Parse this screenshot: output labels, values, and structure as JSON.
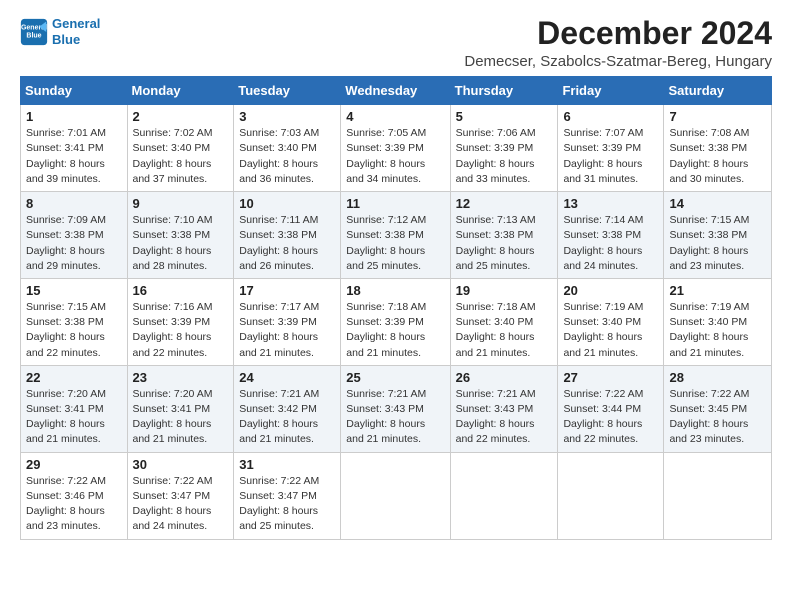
{
  "logo": {
    "line1": "General",
    "line2": "Blue"
  },
  "title": "December 2024",
  "location": "Demecser, Szabolcs-Szatmar-Bereg, Hungary",
  "days_header": [
    "Sunday",
    "Monday",
    "Tuesday",
    "Wednesday",
    "Thursday",
    "Friday",
    "Saturday"
  ],
  "weeks": [
    [
      {
        "num": "1",
        "sunrise": "Sunrise: 7:01 AM",
        "sunset": "Sunset: 3:41 PM",
        "daylight": "Daylight: 8 hours and 39 minutes."
      },
      {
        "num": "2",
        "sunrise": "Sunrise: 7:02 AM",
        "sunset": "Sunset: 3:40 PM",
        "daylight": "Daylight: 8 hours and 37 minutes."
      },
      {
        "num": "3",
        "sunrise": "Sunrise: 7:03 AM",
        "sunset": "Sunset: 3:40 PM",
        "daylight": "Daylight: 8 hours and 36 minutes."
      },
      {
        "num": "4",
        "sunrise": "Sunrise: 7:05 AM",
        "sunset": "Sunset: 3:39 PM",
        "daylight": "Daylight: 8 hours and 34 minutes."
      },
      {
        "num": "5",
        "sunrise": "Sunrise: 7:06 AM",
        "sunset": "Sunset: 3:39 PM",
        "daylight": "Daylight: 8 hours and 33 minutes."
      },
      {
        "num": "6",
        "sunrise": "Sunrise: 7:07 AM",
        "sunset": "Sunset: 3:39 PM",
        "daylight": "Daylight: 8 hours and 31 minutes."
      },
      {
        "num": "7",
        "sunrise": "Sunrise: 7:08 AM",
        "sunset": "Sunset: 3:38 PM",
        "daylight": "Daylight: 8 hours and 30 minutes."
      }
    ],
    [
      {
        "num": "8",
        "sunrise": "Sunrise: 7:09 AM",
        "sunset": "Sunset: 3:38 PM",
        "daylight": "Daylight: 8 hours and 29 minutes."
      },
      {
        "num": "9",
        "sunrise": "Sunrise: 7:10 AM",
        "sunset": "Sunset: 3:38 PM",
        "daylight": "Daylight: 8 hours and 28 minutes."
      },
      {
        "num": "10",
        "sunrise": "Sunrise: 7:11 AM",
        "sunset": "Sunset: 3:38 PM",
        "daylight": "Daylight: 8 hours and 26 minutes."
      },
      {
        "num": "11",
        "sunrise": "Sunrise: 7:12 AM",
        "sunset": "Sunset: 3:38 PM",
        "daylight": "Daylight: 8 hours and 25 minutes."
      },
      {
        "num": "12",
        "sunrise": "Sunrise: 7:13 AM",
        "sunset": "Sunset: 3:38 PM",
        "daylight": "Daylight: 8 hours and 25 minutes."
      },
      {
        "num": "13",
        "sunrise": "Sunrise: 7:14 AM",
        "sunset": "Sunset: 3:38 PM",
        "daylight": "Daylight: 8 hours and 24 minutes."
      },
      {
        "num": "14",
        "sunrise": "Sunrise: 7:15 AM",
        "sunset": "Sunset: 3:38 PM",
        "daylight": "Daylight: 8 hours and 23 minutes."
      }
    ],
    [
      {
        "num": "15",
        "sunrise": "Sunrise: 7:15 AM",
        "sunset": "Sunset: 3:38 PM",
        "daylight": "Daylight: 8 hours and 22 minutes."
      },
      {
        "num": "16",
        "sunrise": "Sunrise: 7:16 AM",
        "sunset": "Sunset: 3:39 PM",
        "daylight": "Daylight: 8 hours and 22 minutes."
      },
      {
        "num": "17",
        "sunrise": "Sunrise: 7:17 AM",
        "sunset": "Sunset: 3:39 PM",
        "daylight": "Daylight: 8 hours and 21 minutes."
      },
      {
        "num": "18",
        "sunrise": "Sunrise: 7:18 AM",
        "sunset": "Sunset: 3:39 PM",
        "daylight": "Daylight: 8 hours and 21 minutes."
      },
      {
        "num": "19",
        "sunrise": "Sunrise: 7:18 AM",
        "sunset": "Sunset: 3:40 PM",
        "daylight": "Daylight: 8 hours and 21 minutes."
      },
      {
        "num": "20",
        "sunrise": "Sunrise: 7:19 AM",
        "sunset": "Sunset: 3:40 PM",
        "daylight": "Daylight: 8 hours and 21 minutes."
      },
      {
        "num": "21",
        "sunrise": "Sunrise: 7:19 AM",
        "sunset": "Sunset: 3:40 PM",
        "daylight": "Daylight: 8 hours and 21 minutes."
      }
    ],
    [
      {
        "num": "22",
        "sunrise": "Sunrise: 7:20 AM",
        "sunset": "Sunset: 3:41 PM",
        "daylight": "Daylight: 8 hours and 21 minutes."
      },
      {
        "num": "23",
        "sunrise": "Sunrise: 7:20 AM",
        "sunset": "Sunset: 3:41 PM",
        "daylight": "Daylight: 8 hours and 21 minutes."
      },
      {
        "num": "24",
        "sunrise": "Sunrise: 7:21 AM",
        "sunset": "Sunset: 3:42 PM",
        "daylight": "Daylight: 8 hours and 21 minutes."
      },
      {
        "num": "25",
        "sunrise": "Sunrise: 7:21 AM",
        "sunset": "Sunset: 3:43 PM",
        "daylight": "Daylight: 8 hours and 21 minutes."
      },
      {
        "num": "26",
        "sunrise": "Sunrise: 7:21 AM",
        "sunset": "Sunset: 3:43 PM",
        "daylight": "Daylight: 8 hours and 22 minutes."
      },
      {
        "num": "27",
        "sunrise": "Sunrise: 7:22 AM",
        "sunset": "Sunset: 3:44 PM",
        "daylight": "Daylight: 8 hours and 22 minutes."
      },
      {
        "num": "28",
        "sunrise": "Sunrise: 7:22 AM",
        "sunset": "Sunset: 3:45 PM",
        "daylight": "Daylight: 8 hours and 23 minutes."
      }
    ],
    [
      {
        "num": "29",
        "sunrise": "Sunrise: 7:22 AM",
        "sunset": "Sunset: 3:46 PM",
        "daylight": "Daylight: 8 hours and 23 minutes."
      },
      {
        "num": "30",
        "sunrise": "Sunrise: 7:22 AM",
        "sunset": "Sunset: 3:47 PM",
        "daylight": "Daylight: 8 hours and 24 minutes."
      },
      {
        "num": "31",
        "sunrise": "Sunrise: 7:22 AM",
        "sunset": "Sunset: 3:47 PM",
        "daylight": "Daylight: 8 hours and 25 minutes."
      },
      null,
      null,
      null,
      null
    ]
  ]
}
